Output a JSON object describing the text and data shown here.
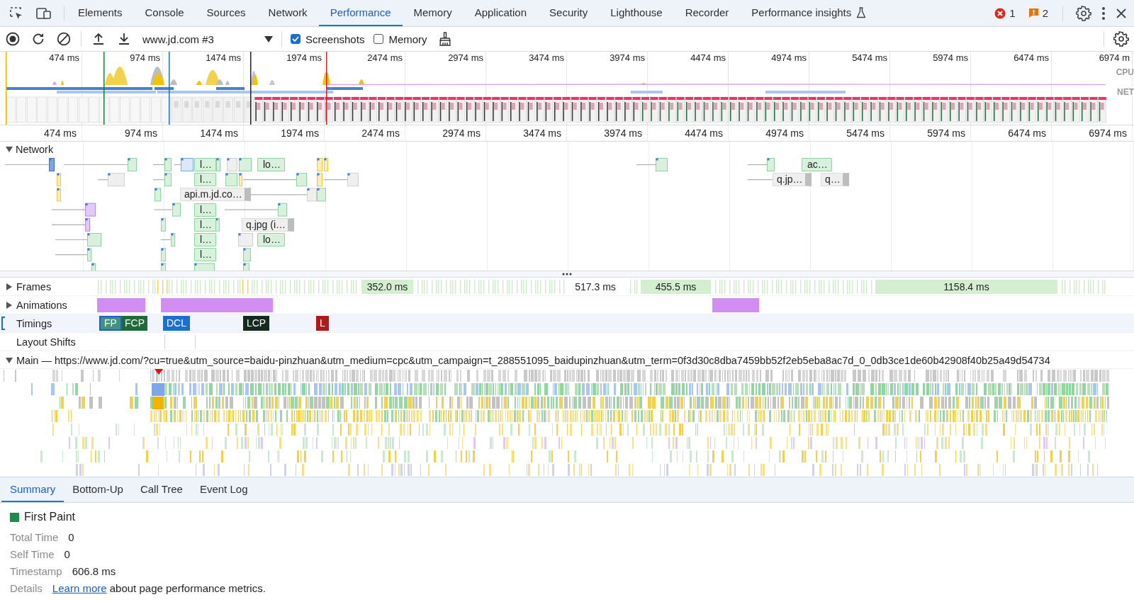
{
  "panel_tabs": [
    {
      "label": "Elements",
      "selected": false,
      "kind": "panel"
    },
    {
      "label": "Console",
      "selected": false,
      "kind": "panel"
    },
    {
      "label": "Sources",
      "selected": false,
      "kind": "panel"
    },
    {
      "label": "Network",
      "selected": false,
      "kind": "panel"
    },
    {
      "label": "Performance",
      "selected": true,
      "kind": "panel"
    },
    {
      "label": "Memory",
      "selected": false,
      "kind": "panel"
    },
    {
      "label": "Application",
      "selected": false,
      "kind": "panel"
    },
    {
      "label": "Security",
      "selected": false,
      "kind": "panel"
    },
    {
      "label": "Lighthouse",
      "selected": false,
      "kind": "panel"
    },
    {
      "label": "Recorder",
      "selected": false,
      "kind": "panel"
    },
    {
      "label": "Performance insights",
      "selected": false,
      "kind": "experimental"
    }
  ],
  "issues": {
    "errors": "1",
    "warnings": "2"
  },
  "recording": {
    "target": "www.jd.com #3",
    "options": [
      {
        "label": "Screenshots",
        "checked": true
      },
      {
        "label": "Memory",
        "checked": false
      }
    ]
  },
  "overview": {
    "time_labels": [
      "474 ms",
      "974 ms",
      "1474 ms",
      "1974 ms",
      "2474 ms",
      "2974 ms",
      "3474 ms",
      "3974 ms",
      "4474 ms",
      "4974 ms",
      "5474 ms",
      "5974 ms",
      "6474 ms",
      "6974 m"
    ],
    "lanes": [
      "CPU",
      "NET"
    ]
  },
  "ruler": {
    "time_labels": [
      "474 ms",
      "974 ms",
      "1474 ms",
      "1974 ms",
      "2474 ms",
      "2974 ms",
      "3474 ms",
      "3974 ms",
      "4474 ms",
      "4974 ms",
      "5474 ms",
      "5974 ms",
      "6474 ms",
      "6974 ms"
    ]
  },
  "network": {
    "title": "Network",
    "expanded": true,
    "requests": [
      {
        "label": "l…",
        "kind": "script"
      },
      {
        "label": "lo…",
        "kind": "script"
      },
      {
        "label": "l…",
        "kind": "script"
      },
      {
        "label": "api.m.jd.co…",
        "kind": "fetch"
      },
      {
        "label": "l…",
        "kind": "script"
      },
      {
        "label": "l…",
        "kind": "script"
      },
      {
        "label": "q.jpg (i…",
        "kind": "image"
      },
      {
        "label": "l…",
        "kind": "script"
      },
      {
        "label": "lo…",
        "kind": "script"
      },
      {
        "label": "l…",
        "kind": "script"
      },
      {
        "label": "ac…",
        "kind": "script"
      },
      {
        "label": "q.jp…",
        "kind": "image"
      },
      {
        "label": "q…",
        "kind": "image"
      }
    ]
  },
  "tracks": [
    {
      "name": "Frames",
      "kind": "frames",
      "expanded": false,
      "selected": false,
      "frames": [
        {
          "label": "352.0 ms",
          "kind": "box"
        },
        {
          "label": "517.3 ms",
          "kind": "plain"
        },
        {
          "label": "455.5 ms",
          "kind": "box"
        },
        {
          "label": "1158.4 ms",
          "kind": "box"
        }
      ]
    },
    {
      "name": "Animations",
      "kind": "animations",
      "expanded": false,
      "selected": false
    },
    {
      "name": "Timings",
      "kind": "timings",
      "selected": true,
      "markers": [
        {
          "label": "FP",
          "color": "#45907f",
          "selected": true
        },
        {
          "label": "FCP",
          "color": "#1e6b3a",
          "selected": false
        },
        {
          "label": "DCL",
          "color": "#1a6fd1",
          "selected": false
        },
        {
          "label": "LCP",
          "color": "#142a1f",
          "selected": false
        },
        {
          "label": "L",
          "color": "#b3181b",
          "selected": false
        }
      ]
    },
    {
      "name": "Layout Shifts",
      "kind": "layout-shifts",
      "selected": false
    },
    {
      "name": "Main — https://www.jd.com/?cu=true&utm_source=baidu-pinzhuan&utm_medium=cpc&utm_campaign=t_288551095_baidupinzhuan&utm_term=0f3d30c8dba7459bb52f2eb5eba8ac7d_0_0db3ce1de60b42908f40b25a49d54734",
      "kind": "main",
      "expanded": true,
      "selected": false
    }
  ],
  "bottom_tabs": [
    {
      "label": "Summary",
      "selected": true
    },
    {
      "label": "Bottom-Up",
      "selected": false
    },
    {
      "label": "Call Tree",
      "selected": false
    },
    {
      "label": "Event Log",
      "selected": false
    }
  ],
  "summary": {
    "title": "First Paint",
    "rows": [
      {
        "label": "Total Time",
        "value": "0"
      },
      {
        "label": "Self Time",
        "value": "0"
      },
      {
        "label": "Timestamp",
        "value": "606.8 ms"
      }
    ],
    "details": {
      "label": "Details",
      "link": "Learn more",
      "text": " about page performance metrics."
    }
  }
}
